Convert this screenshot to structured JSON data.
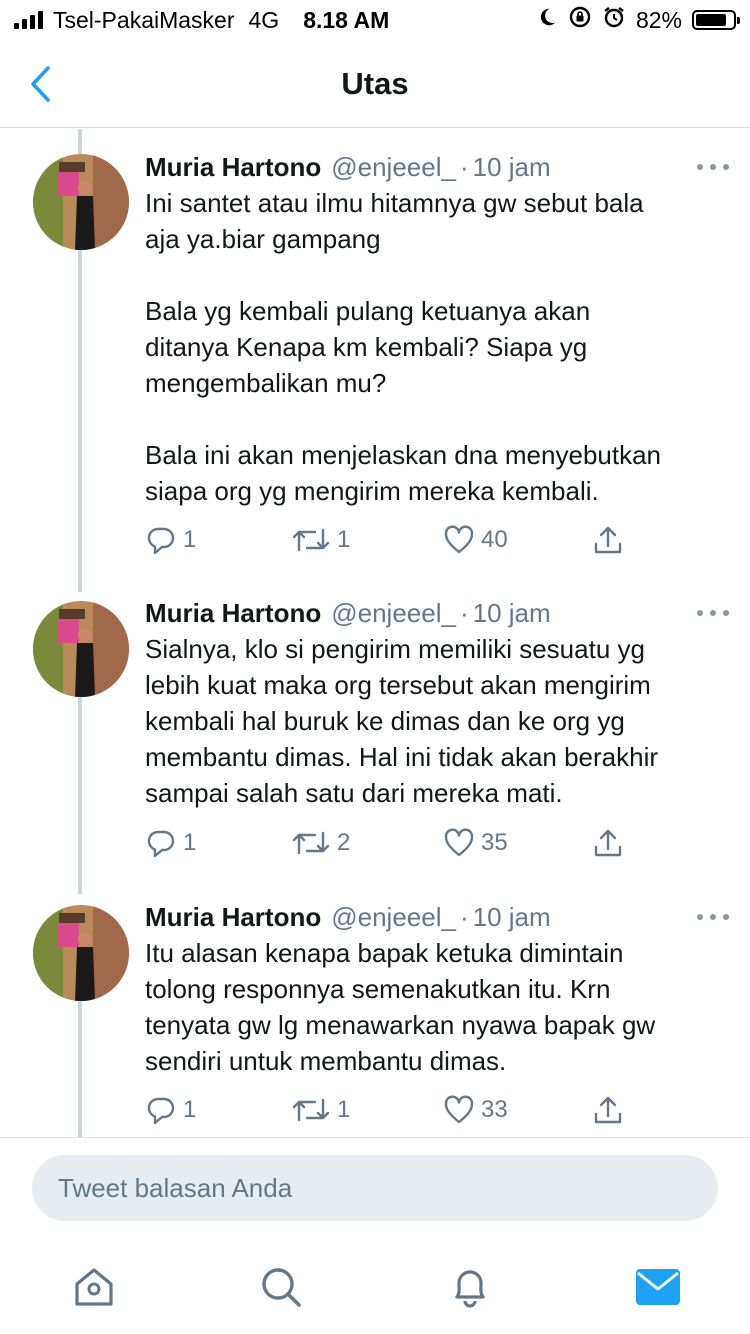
{
  "status_bar": {
    "carrier": "Tsel-PakaiMasker",
    "network": "4G",
    "time": "8.18 AM",
    "battery": "82%",
    "battery_level": 0.82
  },
  "nav": {
    "title": "Utas",
    "back_icon": "chevron-left-icon"
  },
  "colors": {
    "accent": "#1da1f2",
    "text": "#14171a",
    "muted": "#657786",
    "thread_line": "#ccd6dd"
  },
  "tweets": [
    {
      "author": "Muria Hartono",
      "handle": "@enjeeel_",
      "separator": "·",
      "time": "10 jam",
      "text": "Ini santet atau ilmu hitamnya gw sebut bala\naja ya.biar gampang\n\nBala yg kembali pulang ketuanya akan\nditanya Kenapa km kembali? Siapa yg\nmengembalikan mu?\n\nBala ini akan menjelaskan dna menyebutkan\nsiapa org yg mengirim mereka kembali.",
      "replies": "1",
      "retweets": "1",
      "likes": "40"
    },
    {
      "author": "Muria Hartono",
      "handle": "@enjeeel_",
      "separator": "·",
      "time": "10 jam",
      "text": "Sialnya, klo si pengirim memiliki sesuatu yg\nlebih kuat maka org tersebut akan mengirim\nkembali hal buruk ke dimas dan ke org yg\nmembantu dimas. Hal ini tidak akan berakhir\nsampai salah satu dari mereka mati.",
      "replies": "1",
      "retweets": "2",
      "likes": "35"
    },
    {
      "author": "Muria Hartono",
      "handle": "@enjeeel_",
      "separator": "·",
      "time": "10 jam",
      "text": "Itu alasan kenapa bapak ketuka dimintain\ntolong responnya semenakutkan itu. Krn\ntenyata gw lg menawarkan nyawa bapak gw\nsendiri untuk membantu dimas.",
      "replies": "1",
      "retweets": "1",
      "likes": "33"
    }
  ],
  "reply_box": {
    "placeholder": "Tweet balasan Anda"
  },
  "tab_bar": {
    "items": [
      "home-icon",
      "search-icon",
      "notifications-icon",
      "messages-icon"
    ],
    "active": "messages-icon"
  }
}
